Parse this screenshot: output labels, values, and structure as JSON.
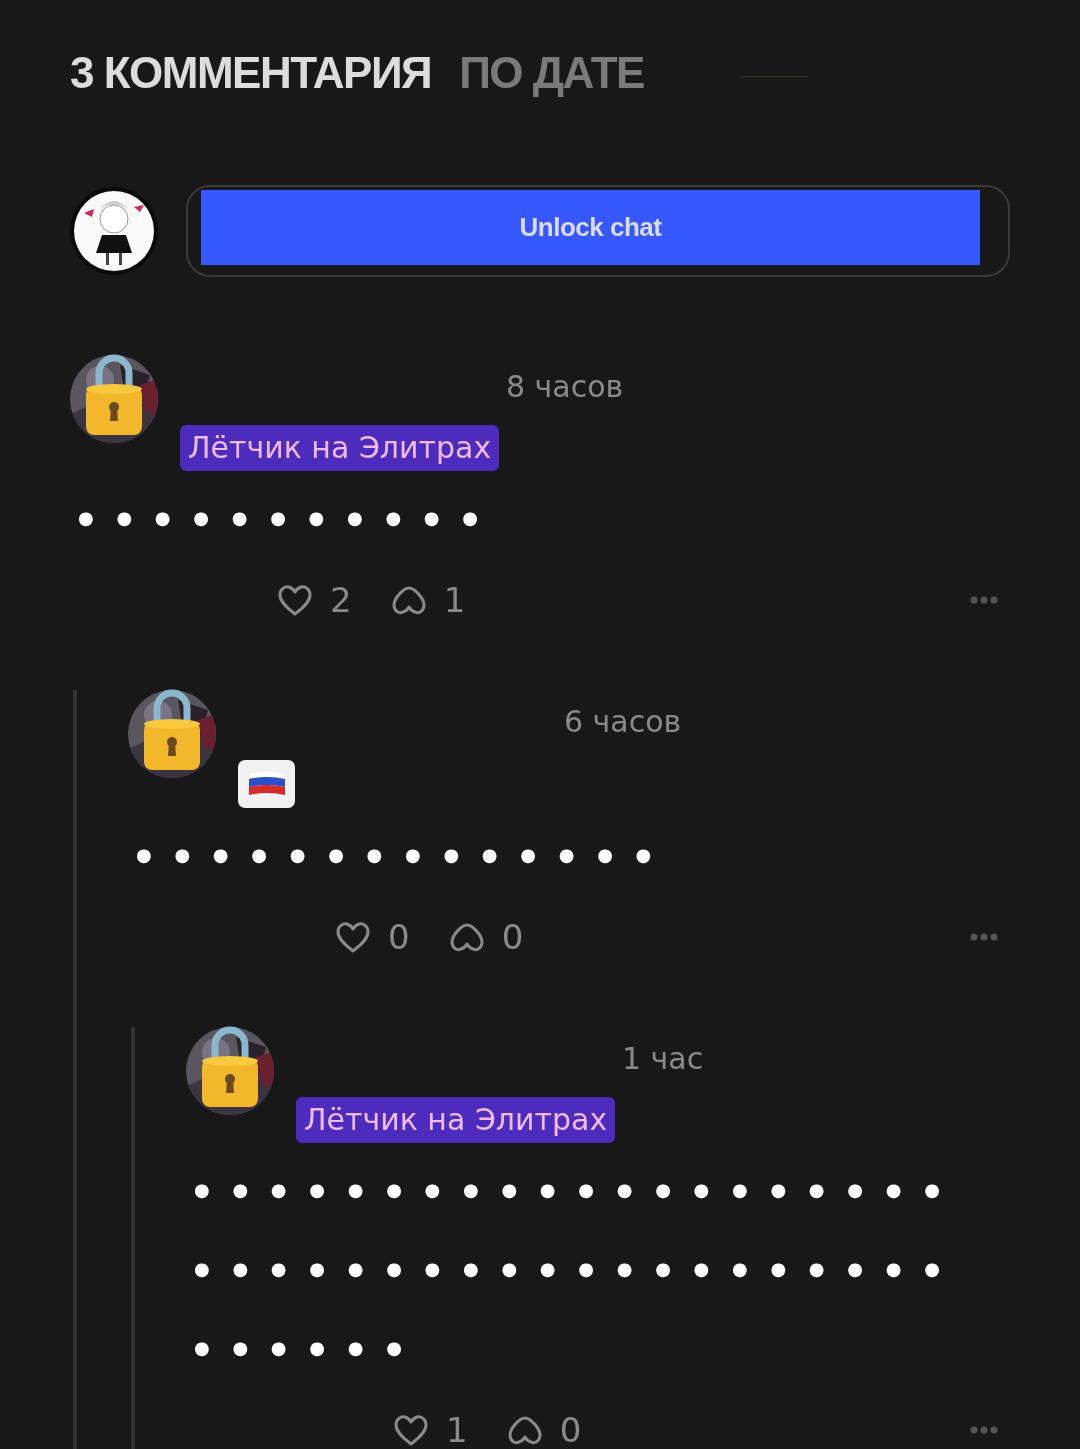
{
  "header": {
    "title": "3 КОММЕНТАРИЯ",
    "sort": "ПО ДАТЕ"
  },
  "composer": {
    "button": "Unlock chat"
  },
  "comments": [
    {
      "time": "8 часов",
      "badge": {
        "kind": "name",
        "text": "Лётчик на Элитрах"
      },
      "lines": [
        "● ● ● ● ● ● ● ● ● ● ●"
      ],
      "likes": "2",
      "reposts": "1",
      "children": [
        {
          "time": "6 часов",
          "badge": {
            "kind": "flag"
          },
          "lines": [
            "● ● ● ● ● ● ● ● ● ● ● ● ● ●"
          ],
          "likes": "0",
          "reposts": "0",
          "children": [
            {
              "time": "1 час",
              "badge": {
                "kind": "name",
                "text": "Лётчик на Элитрах"
              },
              "lines": [
                "● ● ● ● ● ● ● ● ● ● ● ● ● ● ● ● ● ● ● ●",
                "● ● ● ● ● ● ● ● ● ● ● ● ● ● ● ● ● ● ● ●",
                "● ● ● ● ● ●"
              ],
              "likes": "1",
              "reposts": "0"
            }
          ]
        }
      ]
    }
  ]
}
